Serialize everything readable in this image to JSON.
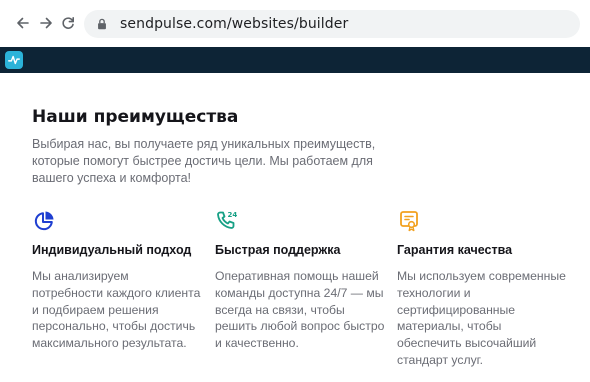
{
  "browser": {
    "url": "sendpulse.com/websites/builder"
  },
  "icons": {
    "back": "arrow-left-icon",
    "forward": "arrow-right-icon",
    "reload": "reload-icon",
    "lock": "lock-icon",
    "logo": "sendpulse-logo-icon"
  },
  "colors": {
    "app_bar": "#0d2436",
    "logo": "#2bb3d9",
    "accent_blue": "#1f3fd1",
    "accent_green": "#16a085",
    "accent_orange": "#f2a11f"
  },
  "section": {
    "title": "Наши преимущества",
    "intro": "Выбирая нас, вы получаете ряд уникальных преимуществ, которые помогут быстрее достичь цели. Мы работаем для вашего успеха и комфорта!"
  },
  "features": [
    {
      "icon": "pie-chart-icon",
      "title": "Индивидуальный подход",
      "text": "Мы анализируем потребности каждого клиента и подбираем решения персонально, чтобы достичь максимального результата."
    },
    {
      "icon": "phone-24-icon",
      "title": "Быстрая поддержка",
      "text": "Оперативная помощь нашей команды доступна 24/7 — мы всегда на связи, чтобы решить любой вопрос быстро и качественно."
    },
    {
      "icon": "certificate-icon",
      "title": "Гарантия качества",
      "text": "Мы используем современные технологии и сертифицированные материалы, чтобы обеспечить высочайший стандарт услуг."
    }
  ]
}
